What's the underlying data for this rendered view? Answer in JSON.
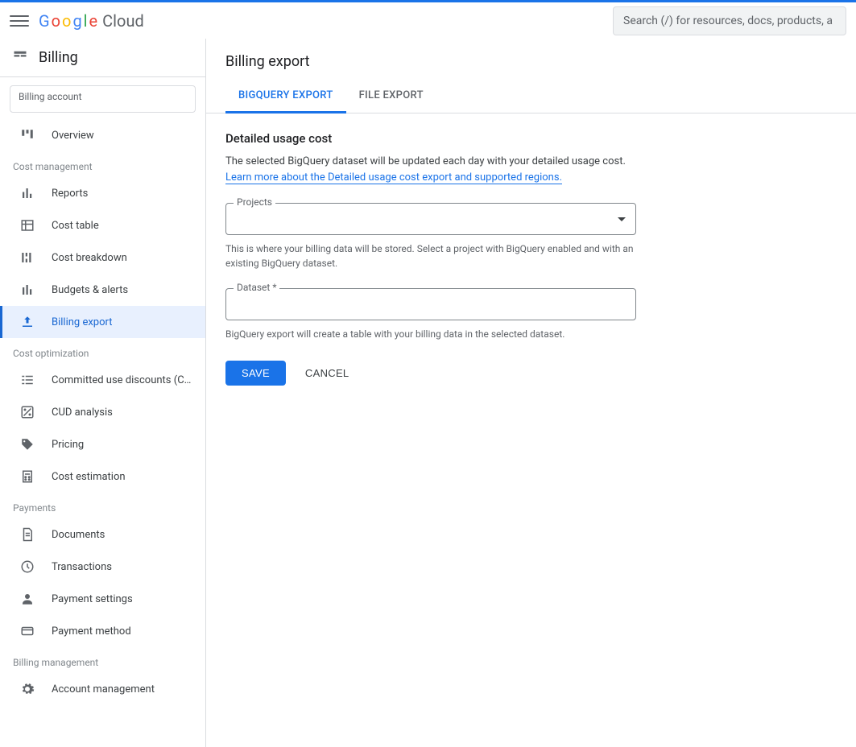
{
  "header": {
    "logo_cloud": "Cloud",
    "search_placeholder": "Search (/) for resources, docs, products, a"
  },
  "sidebar": {
    "title": "Billing",
    "account_label": "Billing account",
    "items": [
      {
        "label": "Overview",
        "icon": "dashboard"
      }
    ],
    "sections": [
      {
        "label": "Cost management",
        "items": [
          {
            "label": "Reports",
            "icon": "bar-chart"
          },
          {
            "label": "Cost table",
            "icon": "table"
          },
          {
            "label": "Cost breakdown",
            "icon": "breakdown"
          },
          {
            "label": "Budgets & alerts",
            "icon": "budget"
          },
          {
            "label": "Billing export",
            "icon": "export",
            "active": true
          }
        ]
      },
      {
        "label": "Cost optimization",
        "items": [
          {
            "label": "Committed use discounts (C…",
            "icon": "list"
          },
          {
            "label": "CUD analysis",
            "icon": "percent"
          },
          {
            "label": "Pricing",
            "icon": "tag"
          },
          {
            "label": "Cost estimation",
            "icon": "calculator"
          }
        ]
      },
      {
        "label": "Payments",
        "items": [
          {
            "label": "Documents",
            "icon": "document"
          },
          {
            "label": "Transactions",
            "icon": "clock"
          },
          {
            "label": "Payment settings",
            "icon": "person"
          },
          {
            "label": "Payment method",
            "icon": "card"
          }
        ]
      },
      {
        "label": "Billing management",
        "items": [
          {
            "label": "Account management",
            "icon": "gear"
          }
        ]
      }
    ]
  },
  "main": {
    "title": "Billing export",
    "tabs": [
      {
        "label": "BIGQUERY EXPORT",
        "active": true
      },
      {
        "label": "FILE EXPORT"
      }
    ],
    "section_heading": "Detailed usage cost",
    "description": "The selected BigQuery dataset will be updated each day with your detailed usage cost.",
    "learn_more": "Learn more about the Detailed usage cost export and supported regions.",
    "projects_label": "Projects",
    "projects_helper": "This is where your billing data will be stored. Select a project with BigQuery enabled and with an existing BigQuery dataset.",
    "dataset_label": "Dataset *",
    "dataset_helper": "BigQuery export will create a table with your billing data in the selected dataset.",
    "save_label": "SAVE",
    "cancel_label": "CANCEL"
  }
}
